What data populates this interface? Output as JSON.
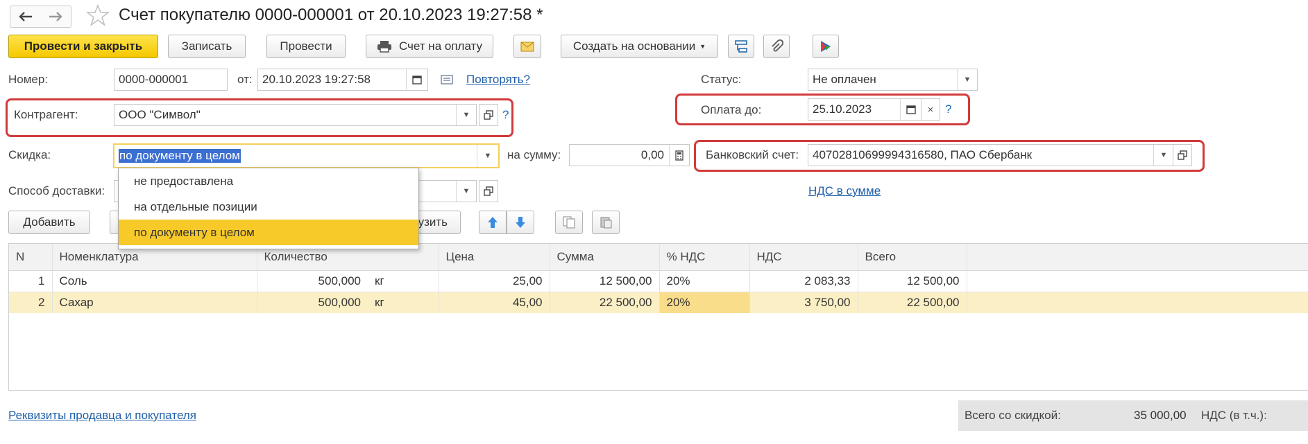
{
  "window": {
    "title": "Счет покупателю 0000-000001 от 20.10.2023 19:27:58 *"
  },
  "toolbar": {
    "post_close": "Провести и закрыть",
    "save": "Записать",
    "post": "Провести",
    "invoice": "Счет на оплату",
    "create_based": "Создать на основании"
  },
  "header": {
    "number_label": "Номер:",
    "number_value": "0000-000001",
    "from_label": "от:",
    "date_value": "20.10.2023 19:27:58",
    "repeat_link": "Повторять?",
    "status_label": "Статус:",
    "status_value": "Не оплачен",
    "contractor_label": "Контрагент:",
    "contractor_value": "ООО \"Символ\"",
    "pay_until_label": "Оплата до:",
    "pay_until_value": "25.10.2023",
    "discount_label": "Скидка:",
    "discount_value": "по документу в целом",
    "sum_label": "на сумму:",
    "sum_value": "0,00",
    "bank_label": "Банковский счет:",
    "bank_value": "40702810699994316580, ПАО Сбербанк",
    "delivery_label": "Способ доставки:",
    "vat_link": "НДС в сумме",
    "question": "?"
  },
  "discount_options": [
    "не предоставлена",
    "на отдельные позиции",
    "по документу в целом"
  ],
  "table_toolbar": {
    "add": "Добавить",
    "load_fragment": "узить"
  },
  "table": {
    "columns": [
      "N",
      "Номенклатура",
      "Количество",
      "",
      "Цена",
      "Сумма",
      "% НДС",
      "НДС",
      "Всего"
    ],
    "rows": [
      [
        "1",
        "Соль",
        "500,000",
        "кг",
        "25,00",
        "12 500,00",
        "20%",
        "2 083,33",
        "12 500,00"
      ],
      [
        "2",
        "Сахар",
        "500,000",
        "кг",
        "45,00",
        "22 500,00",
        "20%",
        "3 750,00",
        "22 500,00"
      ]
    ]
  },
  "footer": {
    "requisites_link": "Реквизиты продавца и покупателя",
    "total_label": "Всего со скидкой:",
    "total_value": "35 000,00",
    "vat_label": "НДС (в т.ч.):"
  },
  "colors": {
    "accent_yellow": "#f5c800",
    "highlight_red": "#d13b3b",
    "link_blue": "#1f5fa8",
    "selection": "#f7ca2a"
  }
}
